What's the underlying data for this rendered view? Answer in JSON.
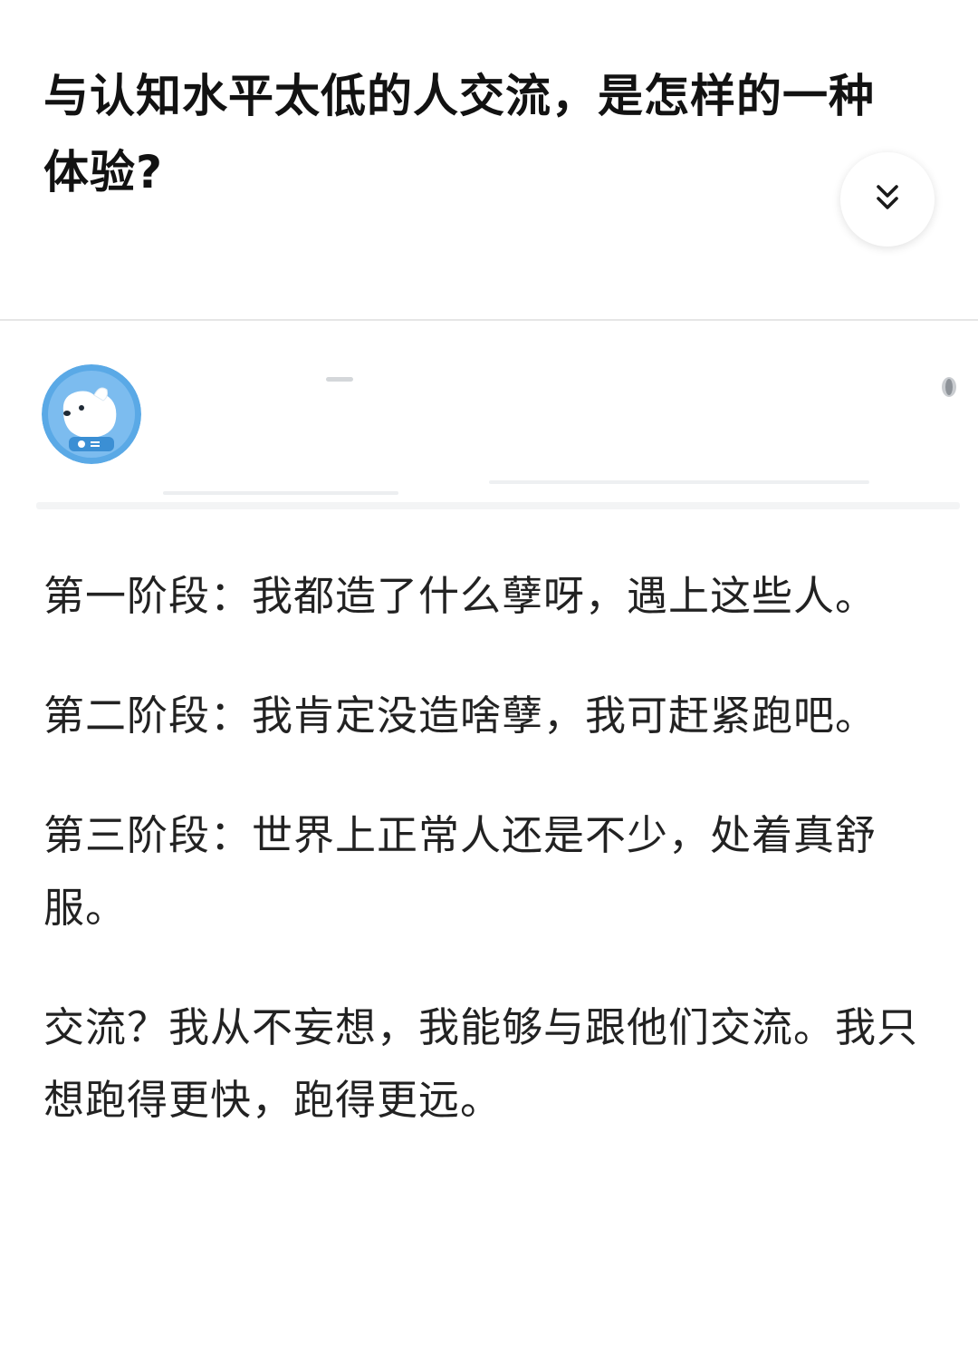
{
  "question": {
    "title": "与认知水平太低的人交流，是怎样的一种体验?"
  },
  "icons": {
    "expand": "double-chevron-down-icon",
    "more": "more-icon",
    "avatar": "dog-avatar"
  },
  "colors": {
    "avatar_bg": "#5aa9e6",
    "text": "#222222",
    "title": "#121212",
    "divider": "#e6e6e6"
  },
  "answer": {
    "paragraphs": [
      "第一阶段：我都造了什么孽呀，遇上这些人。",
      "第二阶段：我肯定没造啥孽，我可赶紧跑吧。",
      "第三阶段：世界上正常人还是不少，处着真舒服。",
      "交流？我从不妄想，我能够与跟他们交流。我只想跑得更快，跑得更远。"
    ]
  }
}
